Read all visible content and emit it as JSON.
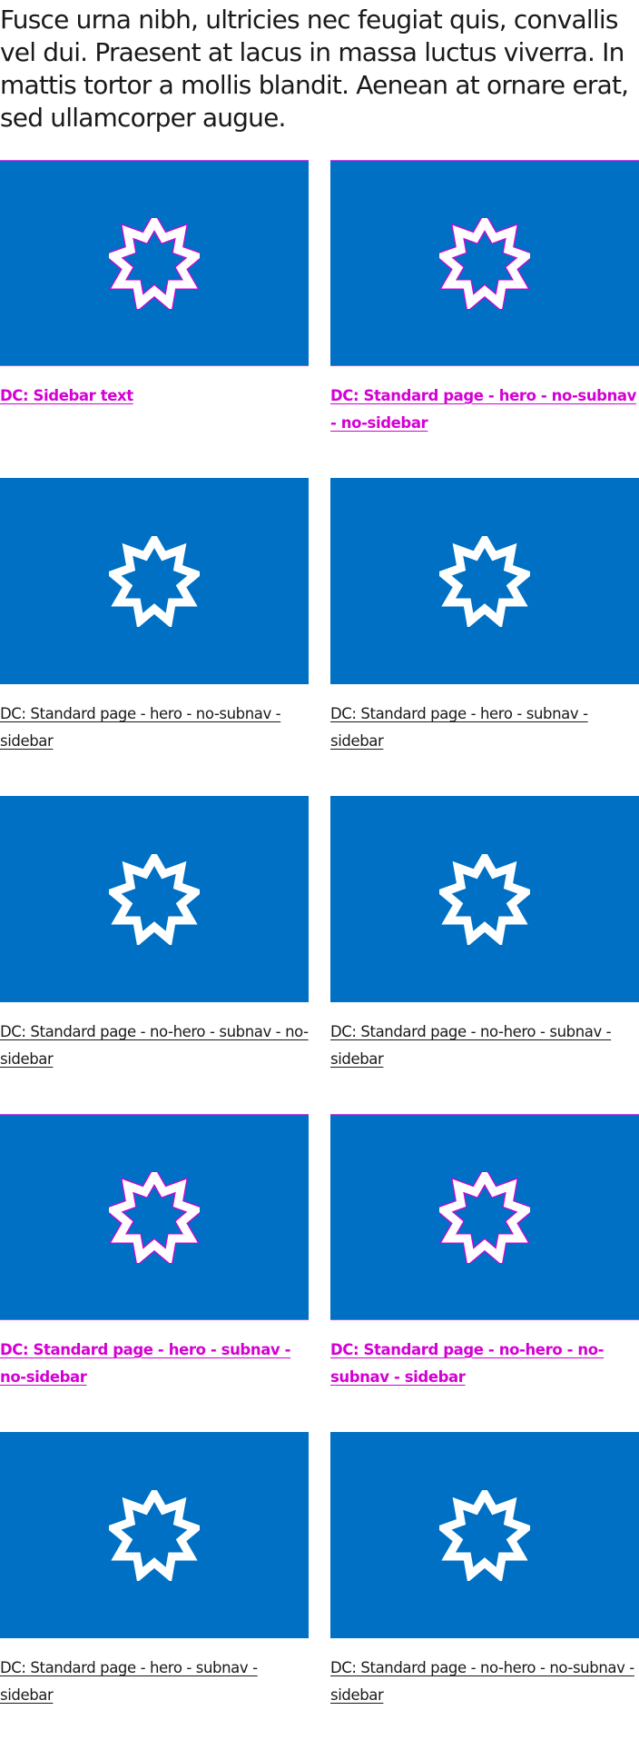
{
  "intro": {
    "text": "Fusce urna nibh, ultricies nec feugiat quis, convallis vel dui. Praesent at lacus in massa luctus viverra. In mattis tortor a mollis blandit. Aenean at ornare erat, sed ullamcorper augue."
  },
  "colors": {
    "thumbnail_background": "#0070c4",
    "star_fill": "#ffffff",
    "highlight": "#d400d4"
  },
  "cards": [
    {
      "caption": "DC: Sidebar text",
      "highlighted": true,
      "icon": "star-icon"
    },
    {
      "caption": "DC: Standard page - hero - no-subnav - no-sidebar",
      "highlighted": true,
      "icon": "star-icon"
    },
    {
      "caption": "DC: Standard page - hero - no-subnav - sidebar",
      "highlighted": false,
      "icon": "star-icon"
    },
    {
      "caption": "DC: Standard page - hero - subnav - sidebar",
      "highlighted": false,
      "icon": "star-icon"
    },
    {
      "caption": "DC: Standard page - no-hero - subnav - no-sidebar",
      "highlighted": false,
      "icon": "star-icon"
    },
    {
      "caption": "DC: Standard page - no-hero - subnav - sidebar",
      "highlighted": false,
      "icon": "star-icon"
    },
    {
      "caption": "DC: Standard page - hero - subnav - no-sidebar",
      "highlighted": true,
      "icon": "star-icon"
    },
    {
      "caption": "DC: Standard page - no-hero - no-subnav - sidebar",
      "highlighted": true,
      "icon": "star-icon"
    },
    {
      "caption": "DC: Standard page - hero - subnav - sidebar",
      "highlighted": false,
      "icon": "star-icon"
    },
    {
      "caption": "DC: Standard page - no-hero - no-subnav - sidebar",
      "highlighted": false,
      "icon": "star-icon"
    }
  ]
}
